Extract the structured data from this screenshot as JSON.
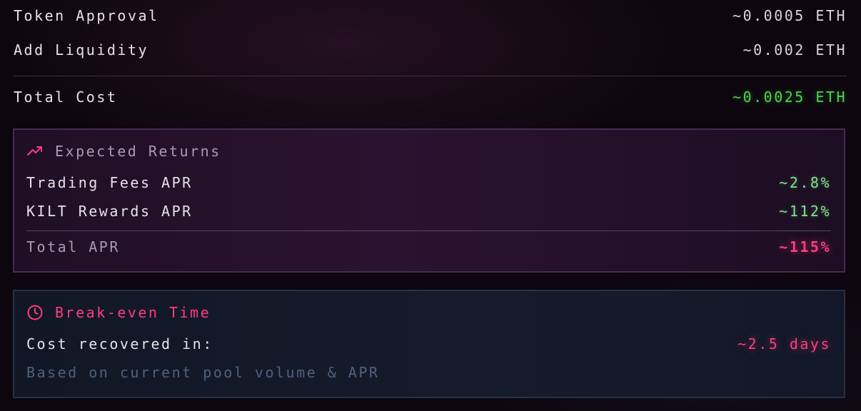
{
  "costs": {
    "items": [
      {
        "label": "Token Approval",
        "value": "~0.0005 ETH"
      },
      {
        "label": "Add Liquidity",
        "value": "~0.002 ETH"
      }
    ],
    "total": {
      "label": "Total Cost",
      "value": "~0.0025 ETH"
    }
  },
  "returns": {
    "title": "Expected Returns",
    "icon": "trending-up-icon",
    "items": [
      {
        "label": "Trading Fees APR",
        "value": "~2.8%"
      },
      {
        "label": "KILT Rewards APR",
        "value": "~112%"
      }
    ],
    "total": {
      "label": "Total APR",
      "value": "~115%"
    }
  },
  "breakeven": {
    "title": "Break-even Time",
    "icon": "clock-icon",
    "label": "Cost recovered in:",
    "value": "~2.5 days",
    "note": "Based on current pool volume & APR"
  },
  "colors": {
    "green": "#4dd44d",
    "pink": "#ff3d7f",
    "returns_border": "#4a2a55",
    "breakeven_border": "#253043"
  }
}
